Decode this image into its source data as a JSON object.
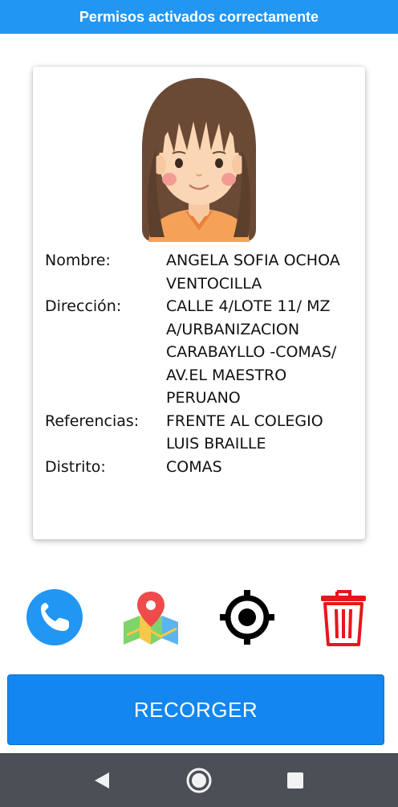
{
  "banner": {
    "text": "Permisos activados correctamente"
  },
  "profile": {
    "avatar_icon": "girl-avatar-icon",
    "rows": [
      {
        "label": "Nombre:",
        "value": "ANGELA SOFIA OCHOA VENTOCILLA"
      },
      {
        "label": "Dirección:",
        "value": "CALLE 4/LOTE 11/ MZ A/URBANIZACION CARABAYLLO -COMAS/ AV.EL MAESTRO PERUANO"
      },
      {
        "label": "Referencias:",
        "value": "FRENTE AL COLEGIO LUIS BRAILLE"
      },
      {
        "label": "Distrito:",
        "value": "COMAS"
      }
    ]
  },
  "actions": [
    {
      "icon": "phone-icon"
    },
    {
      "icon": "map-pin-icon"
    },
    {
      "icon": "crosshair-location-icon"
    },
    {
      "icon": "trash-icon"
    }
  ],
  "main_button": {
    "label": "RECORGER"
  },
  "navbar": {
    "icons": [
      "back-triangle-icon",
      "home-circle-icon",
      "recents-square-icon"
    ]
  },
  "colors": {
    "primary": "#2196f3",
    "button": "#1387ef",
    "delete": "#e8161b",
    "navbar": "#4b4f56"
  }
}
